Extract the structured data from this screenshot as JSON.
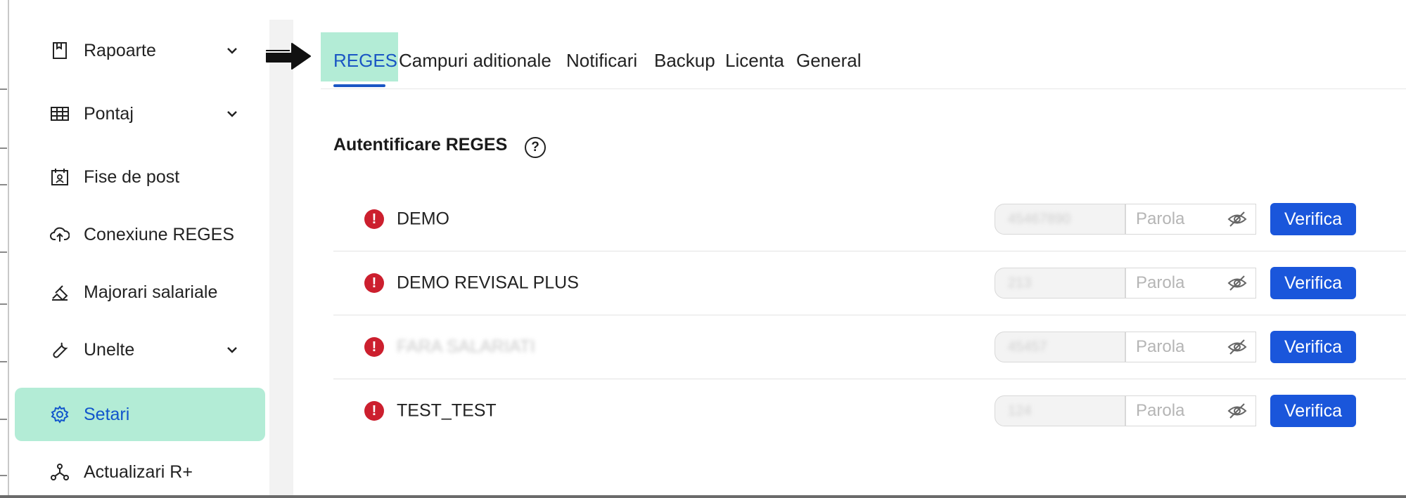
{
  "sidebar": {
    "items": [
      {
        "label": "Rapoarte",
        "icon": "bookmark-icon",
        "expandable": true
      },
      {
        "label": "Pontaj",
        "icon": "grid-table-icon",
        "expandable": true
      },
      {
        "label": "Fise de post",
        "icon": "badge-calendar-icon",
        "expandable": false
      },
      {
        "label": "Conexiune REGES",
        "icon": "cloud-upload-icon",
        "expandable": false
      },
      {
        "label": "Majorari salariale",
        "icon": "edit-tag-icon",
        "expandable": false
      },
      {
        "label": "Unelte",
        "icon": "wrench-icon",
        "expandable": true
      },
      {
        "label": "Setari",
        "icon": "gear-icon",
        "expandable": false,
        "active": true
      },
      {
        "label": "Actualizari R+",
        "icon": "network-nodes-icon",
        "expandable": false
      }
    ]
  },
  "tabs": [
    {
      "label": "REGES",
      "active": true
    },
    {
      "label": "Campuri aditionale"
    },
    {
      "label": "Notificari"
    },
    {
      "label": "Backup"
    },
    {
      "label": "Licenta"
    },
    {
      "label": "General"
    }
  ],
  "section": {
    "title": "Autentificare REGES",
    "help_symbol": "?"
  },
  "accounts": [
    {
      "name": "DEMO",
      "username": "45467890",
      "password_placeholder": "Parola",
      "button": "Verifica",
      "name_blurred": false
    },
    {
      "name": "DEMO REVISAL PLUS",
      "username": "213",
      "password_placeholder": "Parola",
      "button": "Verifica",
      "name_blurred": false
    },
    {
      "name": "FARA SALARIATI",
      "username": "45457",
      "password_placeholder": "Parola",
      "button": "Verifica",
      "name_blurred": true
    },
    {
      "name": "TEST_TEST",
      "username": "124",
      "password_placeholder": "Parola",
      "button": "Verifica",
      "name_blurred": false
    }
  ],
  "colors": {
    "accent": "#1a56db",
    "highlight": "#b3ecd6",
    "error": "#cc1f2e"
  }
}
